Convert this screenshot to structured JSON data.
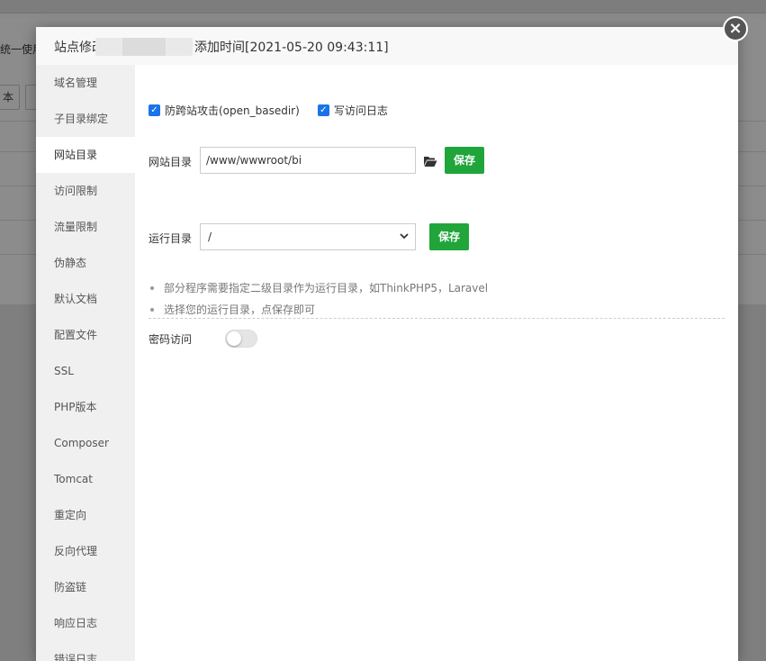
{
  "background": {
    "notice_fragment": "统一使用",
    "button_fragment": "本"
  },
  "dialog": {
    "title_prefix": "站点修改",
    "title_suffix": "添加时间[2021-05-20 09:43:11]",
    "close_label": "×"
  },
  "sidebar": {
    "items": [
      {
        "label": "域名管理",
        "active": false
      },
      {
        "label": "子目录绑定",
        "active": false
      },
      {
        "label": "网站目录",
        "active": true
      },
      {
        "label": "访问限制",
        "active": false
      },
      {
        "label": "流量限制",
        "active": false
      },
      {
        "label": "伪静态",
        "active": false
      },
      {
        "label": "默认文档",
        "active": false
      },
      {
        "label": "配置文件",
        "active": false
      },
      {
        "label": "SSL",
        "active": false
      },
      {
        "label": "PHP版本",
        "active": false
      },
      {
        "label": "Composer",
        "active": false
      },
      {
        "label": "Tomcat",
        "active": false
      },
      {
        "label": "重定向",
        "active": false
      },
      {
        "label": "反向代理",
        "active": false
      },
      {
        "label": "防盗链",
        "active": false
      },
      {
        "label": "响应日志",
        "active": false
      },
      {
        "label": "错误日志",
        "active": false
      }
    ]
  },
  "main": {
    "checkbox_open_basedir": {
      "label": "防跨站攻击(open_basedir)",
      "checked": true
    },
    "checkbox_access_log": {
      "label": "写访问日志",
      "checked": true
    },
    "site_dir": {
      "label": "网站目录",
      "value": "/www/wwwroot/bi",
      "save_label": "保存",
      "icon": "folder-open-icon"
    },
    "run_dir": {
      "label": "运行目录",
      "selected": "/",
      "save_label": "保存"
    },
    "tips": [
      "部分程序需要指定二级目录作为运行目录，如ThinkPHP5，Laravel",
      "选择您的运行目录，点保存即可"
    ],
    "password_access": {
      "label": "密码访问",
      "enabled": false
    }
  },
  "colors": {
    "accent_green": "#20a53a",
    "checkbox_blue": "#1a73e8",
    "sidebar_bg": "#f0f0f0",
    "overlay_gray": "#7f7f7f"
  }
}
